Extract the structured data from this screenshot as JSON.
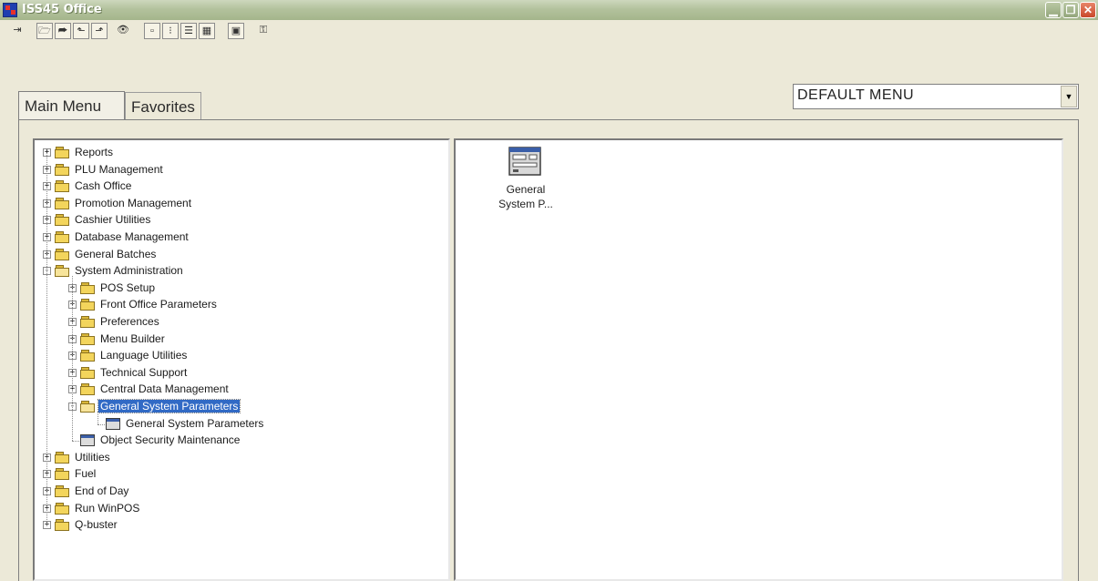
{
  "window": {
    "title": "ISS45 Office"
  },
  "toolbar": {
    "buttons": [
      {
        "name": "exit-icon",
        "glyph": "⇥"
      },
      {
        "name": "open-folder-icon",
        "glyph": "🗁"
      },
      {
        "name": "open-folder-forward-icon",
        "glyph": "⮫"
      },
      {
        "name": "folder-up-icon",
        "glyph": "⬑"
      },
      {
        "name": "folder-next-icon",
        "glyph": "⬏"
      },
      {
        "name": "find-binoculars-icon",
        "glyph": "👁"
      },
      {
        "name": "large-icons-view-icon",
        "glyph": "▫"
      },
      {
        "name": "small-icons-view-icon",
        "glyph": "⁝"
      },
      {
        "name": "list-view-icon",
        "glyph": "☰"
      },
      {
        "name": "details-view-icon",
        "glyph": "▦"
      },
      {
        "name": "properties-icon",
        "glyph": "▣"
      },
      {
        "name": "key-icon",
        "glyph": "⚿"
      }
    ]
  },
  "tabs": [
    {
      "label": "Main Menu",
      "active": true
    },
    {
      "label": "Favorites",
      "active": false
    }
  ],
  "menu_select": {
    "value": "DEFAULT MENU"
  },
  "tree": [
    {
      "label": "Reports",
      "level": 0,
      "type": "folder",
      "expander": "+"
    },
    {
      "label": "PLU Management",
      "level": 0,
      "type": "folder",
      "expander": "+"
    },
    {
      "label": "Cash Office",
      "level": 0,
      "type": "folder",
      "expander": "+"
    },
    {
      "label": "Promotion Management",
      "level": 0,
      "type": "folder",
      "expander": "+"
    },
    {
      "label": "Cashier Utilities",
      "level": 0,
      "type": "folder",
      "expander": "+"
    },
    {
      "label": "Database Management",
      "level": 0,
      "type": "folder",
      "expander": "+"
    },
    {
      "label": "General Batches",
      "level": 0,
      "type": "folder",
      "expander": "+"
    },
    {
      "label": "System Administration",
      "level": 0,
      "type": "open-folder",
      "expander": "−"
    },
    {
      "label": "POS Setup",
      "level": 1,
      "type": "folder",
      "expander": "+"
    },
    {
      "label": "Front Office Parameters",
      "level": 1,
      "type": "folder",
      "expander": "+"
    },
    {
      "label": "Preferences",
      "level": 1,
      "type": "folder",
      "expander": "+"
    },
    {
      "label": "Menu Builder",
      "level": 1,
      "type": "folder",
      "expander": "+"
    },
    {
      "label": "Language Utilities",
      "level": 1,
      "type": "folder",
      "expander": "+"
    },
    {
      "label": "Technical Support",
      "level": 1,
      "type": "folder",
      "expander": "+"
    },
    {
      "label": "Central Data Management",
      "level": 1,
      "type": "folder",
      "expander": "+"
    },
    {
      "label": "General System Parameters",
      "level": 1,
      "type": "open-folder",
      "expander": "−",
      "selected": true
    },
    {
      "label": "General System Parameters",
      "level": 2,
      "type": "form",
      "expander": ""
    },
    {
      "label": "Object Security Maintenance",
      "level": 1,
      "type": "form",
      "expander": ""
    },
    {
      "label": "Utilities",
      "level": 0,
      "type": "folder",
      "expander": "+"
    },
    {
      "label": "Fuel",
      "level": 0,
      "type": "folder",
      "expander": "+"
    },
    {
      "label": "End of Day",
      "level": 0,
      "type": "folder",
      "expander": "+"
    },
    {
      "label": "Run WinPOS",
      "level": 0,
      "type": "folder",
      "expander": "+"
    },
    {
      "label": "Q-buster",
      "level": 0,
      "type": "folder",
      "expander": "+"
    }
  ],
  "content_items": [
    {
      "label_line1": "General",
      "label_line2": "System P..."
    }
  ]
}
